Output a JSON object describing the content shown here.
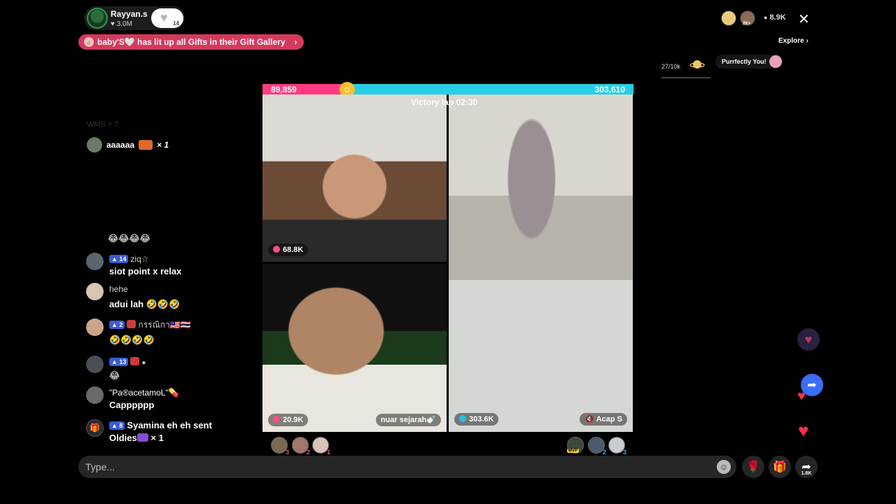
{
  "host": {
    "name": "Rayyan.s",
    "likes": "3.0M",
    "badge_count": "14"
  },
  "banner": {
    "text": "baby'S🤍 has lit up all Gifts in their Gift Gallery",
    "chevron": "›"
  },
  "top_right": {
    "viewer_count": "8.9K",
    "viewer_icon": "person-icon",
    "close": "✕",
    "explore": "Explore ›",
    "viewer_badge": "2K+"
  },
  "goal": {
    "progress": "27/10k",
    "progress_fraction": 0.0027
  },
  "gift_promo": {
    "label": "Purrfectly You!"
  },
  "battle": {
    "left_score": "89,859",
    "right_score": "303,610",
    "left_fraction": 0.228,
    "timer": "Victory lap  02:30",
    "tiles": [
      {
        "score": "68.8K"
      },
      {
        "score": "20.9K",
        "name": "nuar sejarah🍼"
      },
      {
        "score": "303.6K",
        "name": "Acap S"
      }
    ],
    "left_ranks": [
      "3",
      "2",
      "1"
    ],
    "right_ranks": [
      "",
      "2",
      "3"
    ],
    "mvp": "MVP"
  },
  "chat": {
    "faded": "WMS  × 7",
    "join": {
      "user": "aaaaaa",
      "count": "× 1"
    },
    "top_emoji": "😂😂😂😂",
    "messages": [
      {
        "level": "14",
        "name": "ziq☆",
        "text": "siot point x relax"
      },
      {
        "level": "",
        "name": "hehe",
        "text": "adui lah 🤣🤣🤣"
      },
      {
        "level": "2",
        "name": "กรรณิกา🇲🇾🇹🇭",
        "text": "🤣🤣🤣🤣"
      },
      {
        "level": "13",
        "name": "",
        "text": "😂"
      },
      {
        "level": "",
        "name": "\"Pa®acetamoL\"💊",
        "text": "Capppppp"
      },
      {
        "level": "8",
        "name": "Syamina eh eh",
        "sent": "sent",
        "text": "Oldies",
        "count": "× 1"
      }
    ]
  },
  "bottom": {
    "placeholder": "Type...",
    "share_count": "1.8K"
  },
  "colors": {
    "accent_pink": "#ff3c82",
    "accent_cyan": "#27cfe6",
    "banner": "#d43a5d",
    "share": "#3b6ef5",
    "heart": "#ff2d4d"
  }
}
